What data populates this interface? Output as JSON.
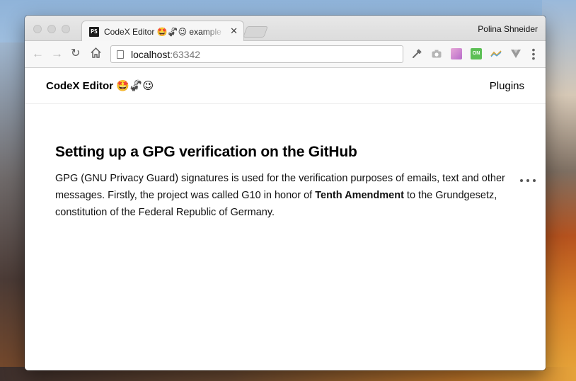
{
  "browser": {
    "tab": {
      "favicon_text": "PS",
      "title": "CodeX Editor 🤩🦨😉 example",
      "close_glyph": "✕"
    },
    "profile_name": "Polina Shneider",
    "omnibox": {
      "host": "localhost",
      "port": ":63342"
    },
    "extensions": [
      "eyedropper-icon",
      "camera-icon",
      "pink-extension-icon",
      "on-extension-icon",
      "wave-extension-icon",
      "vue-devtools-icon"
    ],
    "extension_green_label": "ON",
    "menu_glyph": "⋮"
  },
  "site": {
    "brand_name": "CodeX Editor",
    "brand_emoji": "🤩🦨😉",
    "nav_plugins": "Plugins"
  },
  "article": {
    "title": "Setting up a GPG verification on the GitHub",
    "paragraph_pre": "GPG (GNU Privacy Guard) signatures is used for the verification purposes of emails, text and other messages. Firstly, the project was called G10 in honor of ",
    "paragraph_bold": "Tenth Amendment",
    "paragraph_post": " to the Grundgesetz, constitution of the Federal Republic of Germany."
  },
  "colors": {
    "accent": "#000000",
    "page_bg": "#ffffff",
    "chrome_bg": "#dcdcdc"
  }
}
